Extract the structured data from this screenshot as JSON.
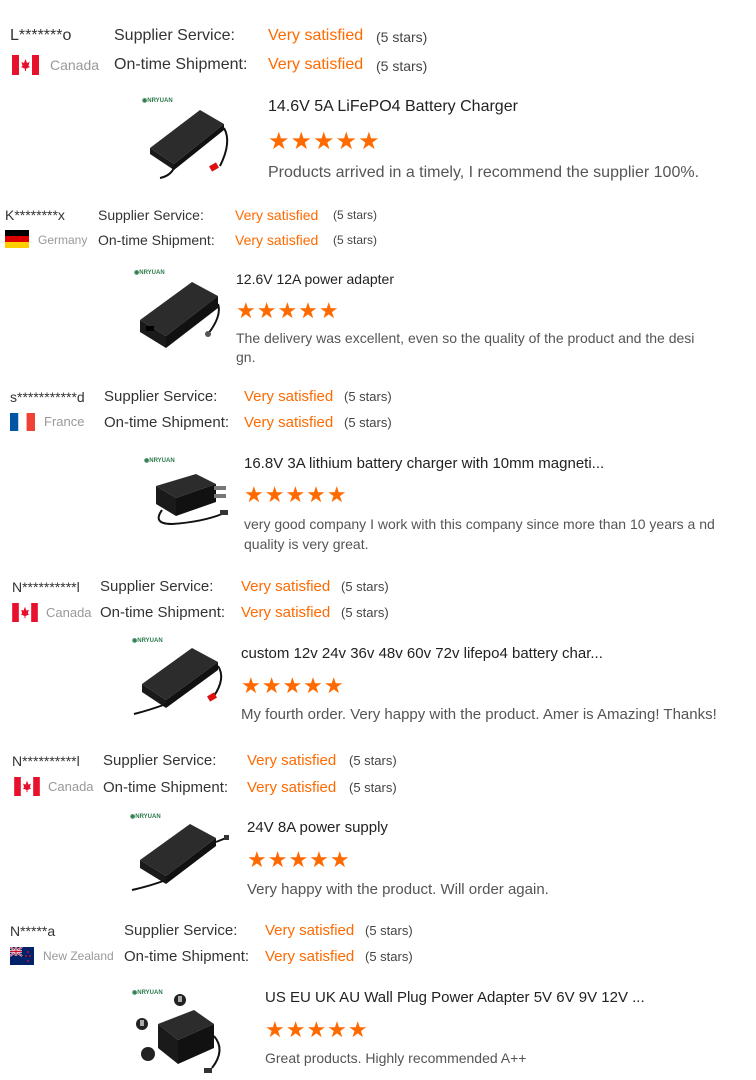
{
  "labels": {
    "service": "Supplier Service:",
    "shipment": "On-time Shipment:"
  },
  "stars_glyph": "★★★★★",
  "reviews": [
    {
      "user": "L*******o",
      "country": "Canada",
      "service": "Very satisfied",
      "service_stars": "(5 stars)",
      "shipment": "Very satisfied",
      "shipment_stars": "(5 stars)",
      "product": "14.6V 5A LiFePO4 Battery Charger",
      "comment": "Products arrived in a timely, I recommend the supplier 100%."
    },
    {
      "user": "K********x",
      "country": "Germany",
      "service": "Very satisfied",
      "service_stars": "(5 stars)",
      "shipment": "Very satisfied",
      "shipment_stars": "(5 stars)",
      "product": "12.6V 12A power adapter",
      "comment": "The delivery was excellent, even so the quality of the product and the desi gn."
    },
    {
      "user": "s***********d",
      "country": "France",
      "service": "Very satisfied",
      "service_stars": "(5 stars)",
      "shipment": "Very satisfied",
      "shipment_stars": "(5 stars)",
      "product": "16.8V 3A lithium battery charger with 10mm magneti...",
      "comment": "very good company I work with this company since more than 10 years a nd quality is very great."
    },
    {
      "user": "N**********l",
      "country": "Canada",
      "service": "Very satisfied",
      "service_stars": "(5 stars)",
      "shipment": "Very satisfied",
      "shipment_stars": "(5 stars)",
      "product": "custom 12v 24v 36v 48v 60v 72v lifepo4 battery char...",
      "comment": "My fourth order. Very happy with the product. Amer is Amazing! Thanks!"
    },
    {
      "user": "N**********l",
      "country": "Canada",
      "service": "Very satisfied",
      "service_stars": "(5 stars)",
      "shipment": "Very satisfied",
      "shipment_stars": "(5 stars)",
      "product": "24V 8A power supply",
      "comment": "Very happy with the product. Will order again."
    },
    {
      "user": "N*****a",
      "country": "New Zealand",
      "service": "Very satisfied",
      "service_stars": "(5 stars)",
      "shipment": "Very satisfied",
      "shipment_stars": "(5 stars)",
      "product": "US EU UK AU Wall Plug Power Adapter 5V 6V 9V 12V ...",
      "comment": "Great products. Highly recommended A++"
    }
  ],
  "colors": {
    "accent": "#ff6a00",
    "text": "#333333",
    "muted": "#999999"
  }
}
